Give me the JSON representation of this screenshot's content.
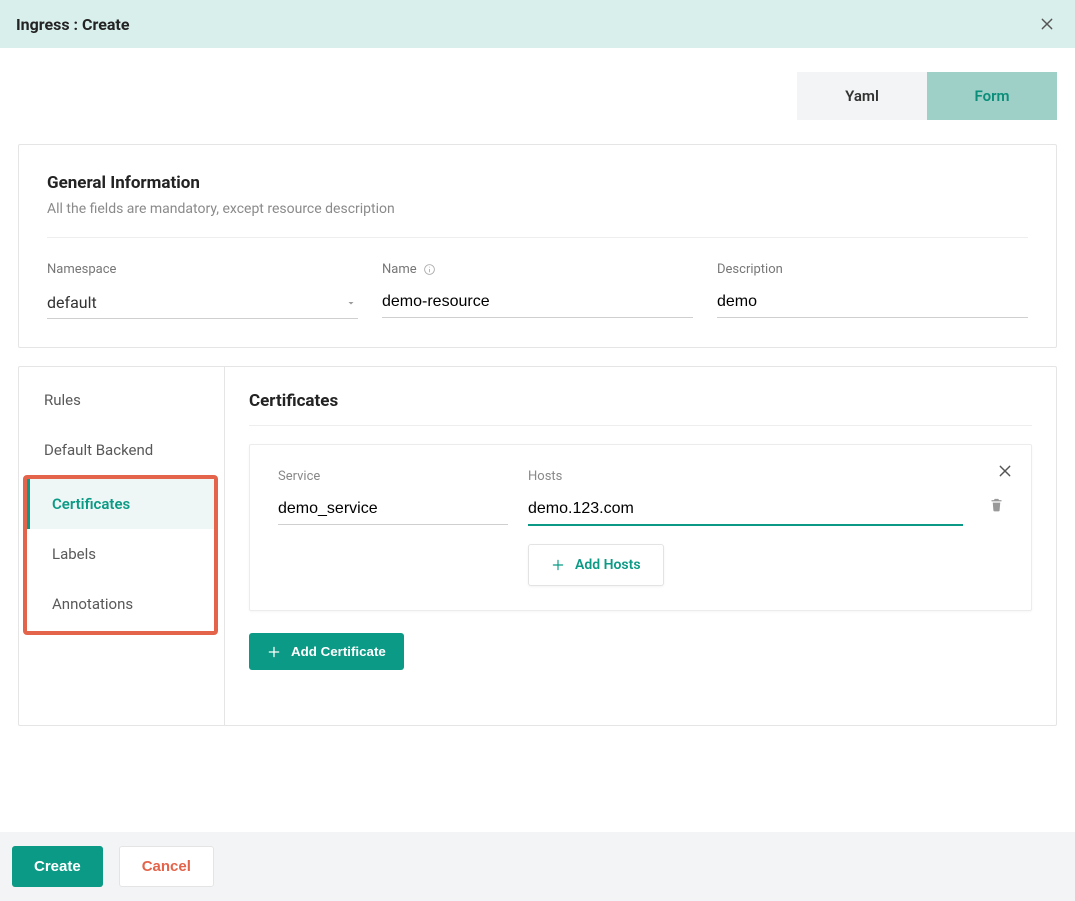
{
  "header": {
    "title": "Ingress : Create"
  },
  "toggle": {
    "yaml": "Yaml",
    "form": "Form"
  },
  "general": {
    "title": "General Information",
    "subtitle": "All the fields are mandatory, except resource description",
    "namespace_label": "Namespace",
    "namespace_value": "default",
    "name_label": "Name",
    "name_value": "demo-resource",
    "description_label": "Description",
    "description_value": "demo"
  },
  "sidebar": {
    "items": [
      {
        "label": "Rules"
      },
      {
        "label": "Default Backend"
      },
      {
        "label": "Certificates"
      },
      {
        "label": "Labels"
      },
      {
        "label": "Annotations"
      }
    ]
  },
  "certificates": {
    "title": "Certificates",
    "service_label": "Service",
    "service_value": "demo_service",
    "hosts_label": "Hosts",
    "hosts_value": "demo.123.com",
    "add_hosts": "Add Hosts",
    "add_certificate": "Add Certificate"
  },
  "footer": {
    "create": "Create",
    "cancel": "Cancel"
  }
}
